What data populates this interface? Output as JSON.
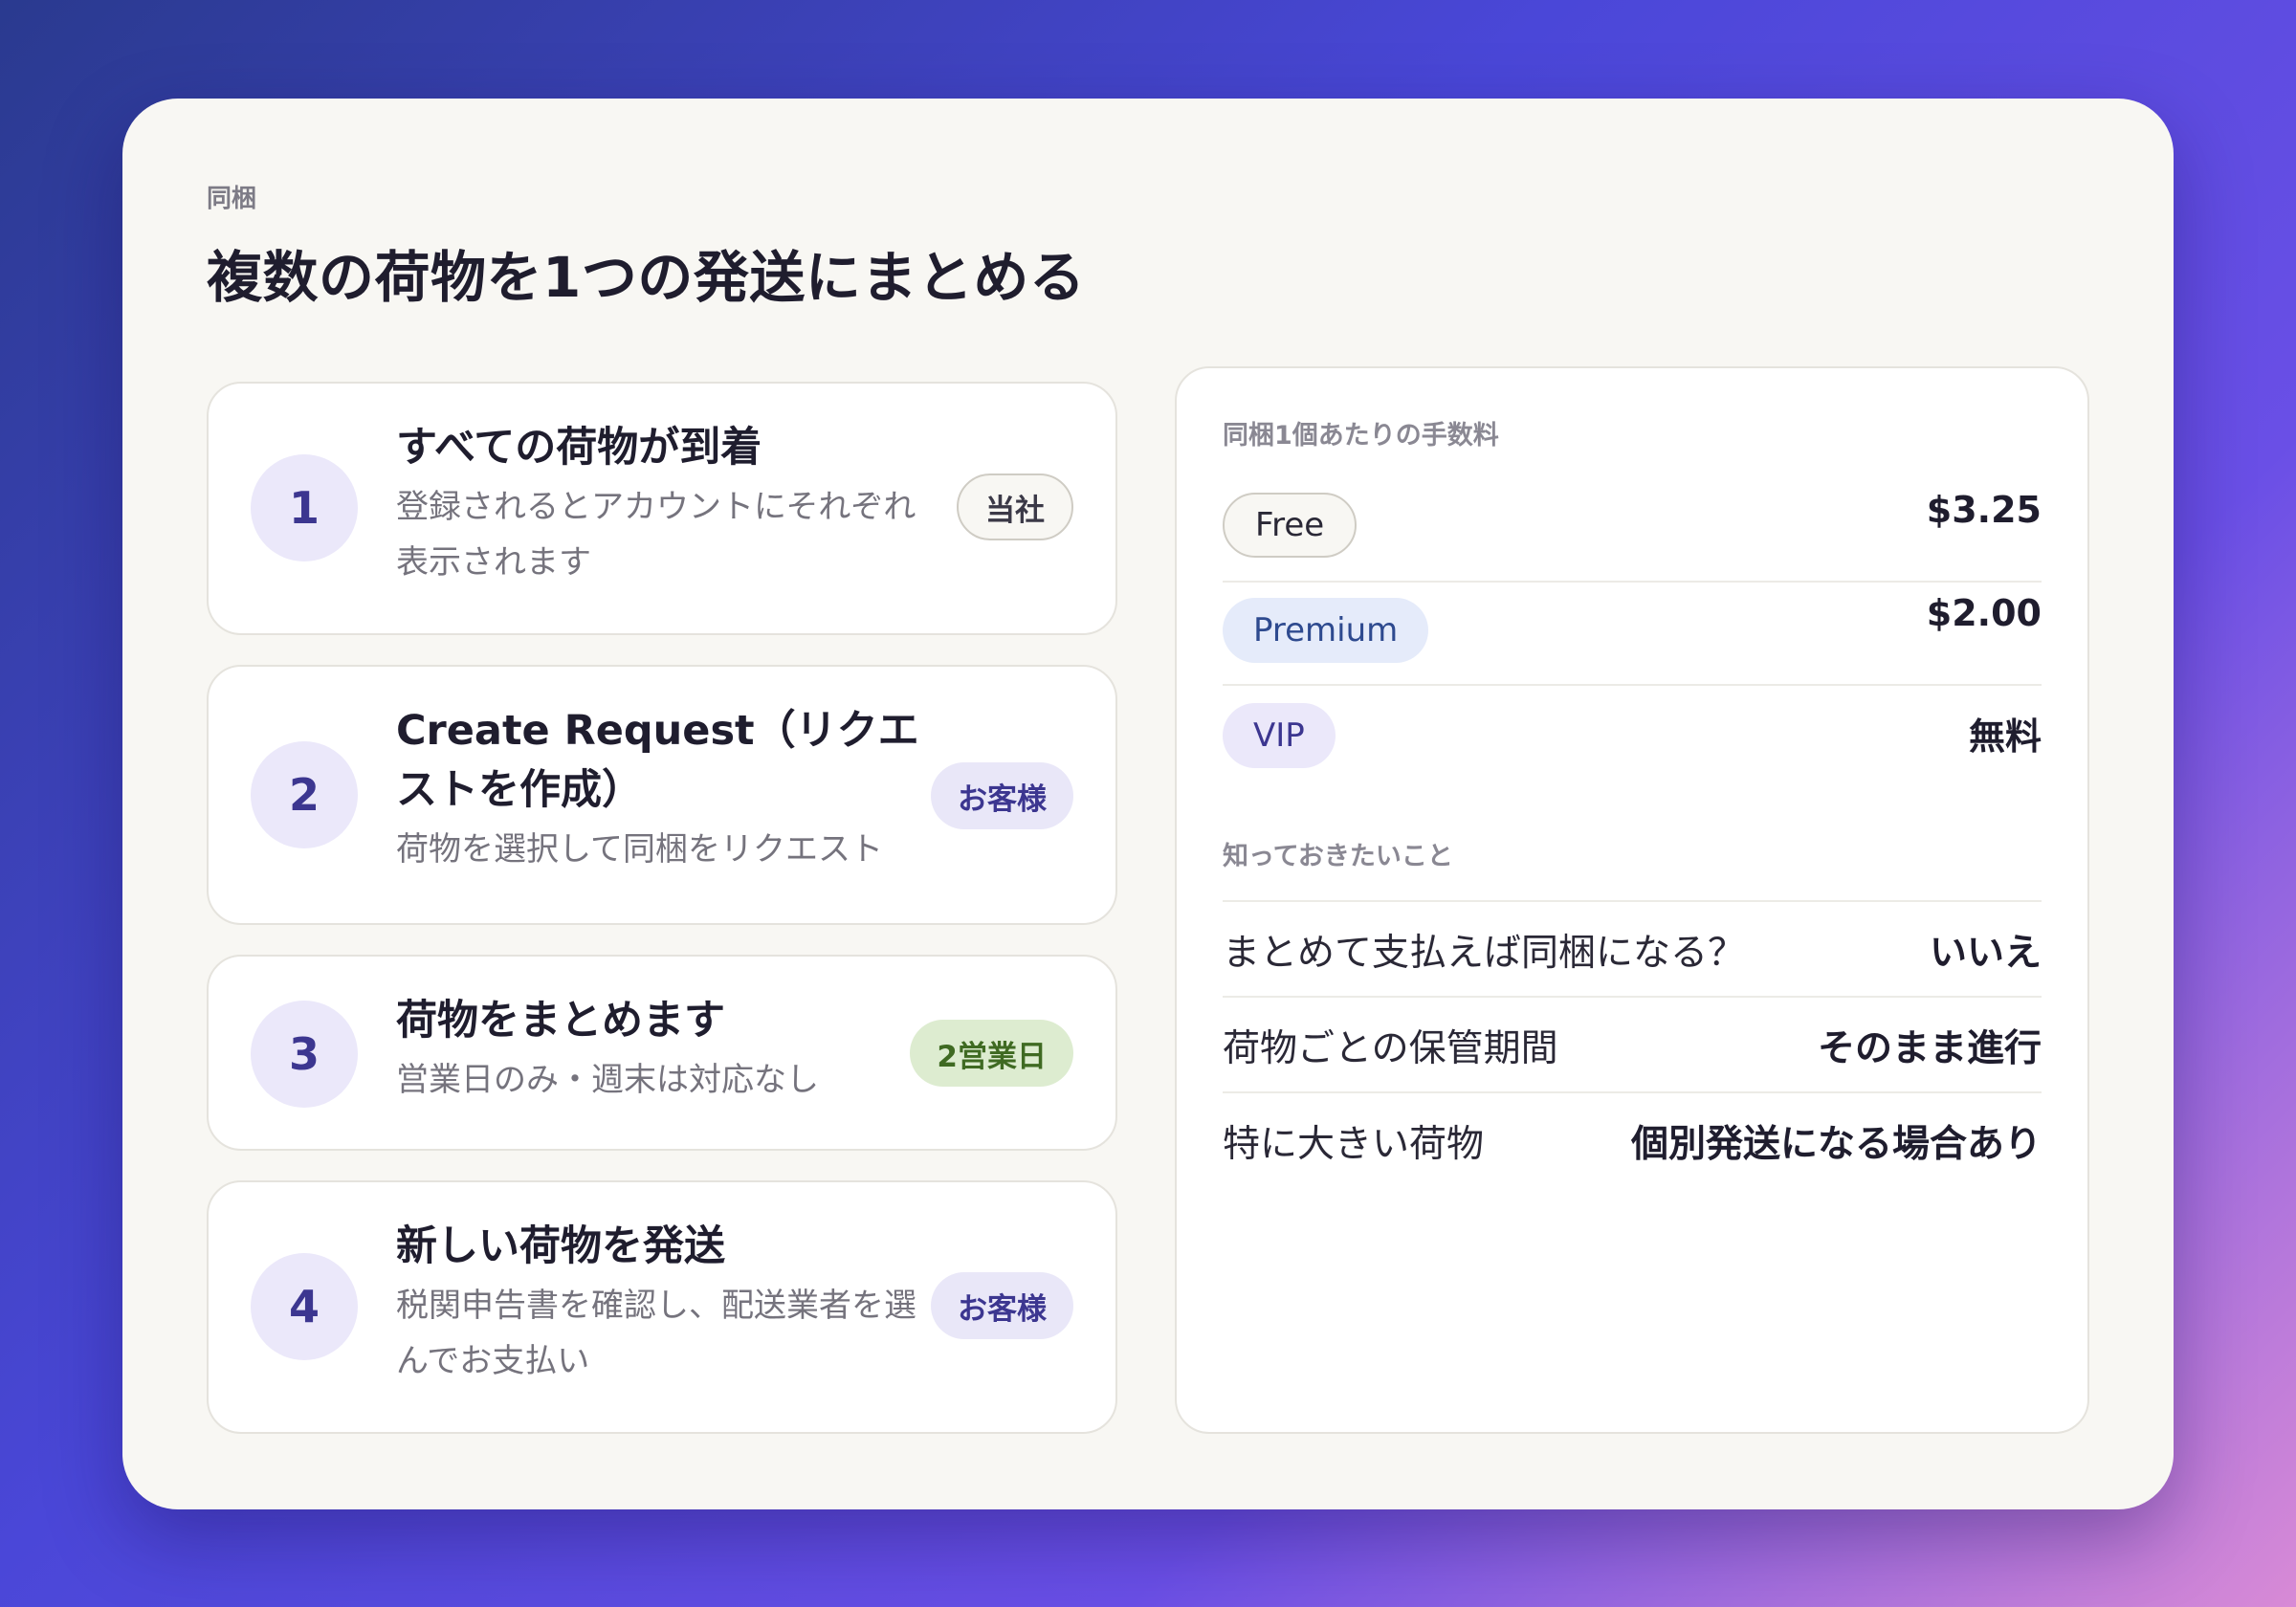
{
  "header": {
    "eyebrow": "同梱",
    "title": "複数の荷物を1つの発送にまとめる"
  },
  "steps": [
    {
      "number": "1",
      "title": "すべての荷物が到着",
      "description": "登録されるとアカウントにそれぞれ表示されます",
      "tag": "当社"
    },
    {
      "number": "2",
      "title": "Create Request（リクエストを作成）",
      "description": "荷物を選択して同梱をリクエスト",
      "tag": "お客様"
    },
    {
      "number": "3",
      "title": "荷物をまとめます",
      "description": "営業日のみ・週末は対応なし",
      "tag": "2営業日"
    },
    {
      "number": "4",
      "title": "新しい荷物を発送",
      "description": "税関申告書を確認し、配送業者を選んでお支払い",
      "tag": "お客様"
    }
  ],
  "fees": {
    "heading": "同梱1個あたりの手数料",
    "rows": [
      {
        "plan": "Free",
        "price": "$3.25"
      },
      {
        "plan": "Premium",
        "price": "$2.00"
      },
      {
        "plan": "VIP",
        "price": "無料"
      }
    ]
  },
  "faq": {
    "heading": "知っておきたいこと",
    "rows": [
      {
        "question": "まとめて支払えば同梱になる？",
        "answer": "いいえ"
      },
      {
        "question": "荷物ごとの保管期間",
        "answer": "そのまま進行"
      },
      {
        "question": "特に大きい荷物",
        "answer": "個別発送になる場合あり"
      }
    ]
  }
}
